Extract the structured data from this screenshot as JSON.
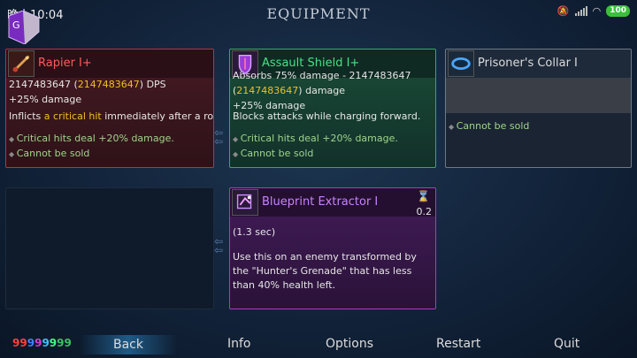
{
  "status": {
    "time": "晚上10:04",
    "battery": "100"
  },
  "title": "EQUIPMENT",
  "cards": {
    "rapier": {
      "name": "Rapier I+",
      "dps_prefix": "2147483647 (",
      "dps_value": "2147483647",
      "dps_suffix": ") DPS",
      "damage": "+25% damage",
      "desc_a": "Inflicts ",
      "desc_hl": "a critical hit",
      "desc_b": " immediately after a roll.",
      "bullet1": "Critical hits deal +20% damage.",
      "bullet2": "Cannot be sold"
    },
    "shield": {
      "name": "Assault Shield I+",
      "absorb": "Absorbs 75% damage - 2147483647",
      "dmg_value": "2147483647",
      "dmg_suffix": " damage",
      "damage": "+25% damage",
      "desc": "Blocks attacks while charging forward.",
      "bullet1": "Critical hits deal +20% damage.",
      "bullet2": "Cannot be sold"
    },
    "collar": {
      "name": "Prisoner's Collar I",
      "bullet1": "Cannot be sold"
    },
    "extractor": {
      "name": "Blueprint Extractor I",
      "cooldown": "0.2",
      "duration": "(1.3 sec)",
      "desc": "Use this on an enemy transformed by the \"Hunter's Grenade\" that has less than 40% health left."
    }
  },
  "debug_counter": "99999999",
  "nav": {
    "back": "Back",
    "info": "Info",
    "options": "Options",
    "restart": "Restart",
    "quit": "Quit"
  }
}
